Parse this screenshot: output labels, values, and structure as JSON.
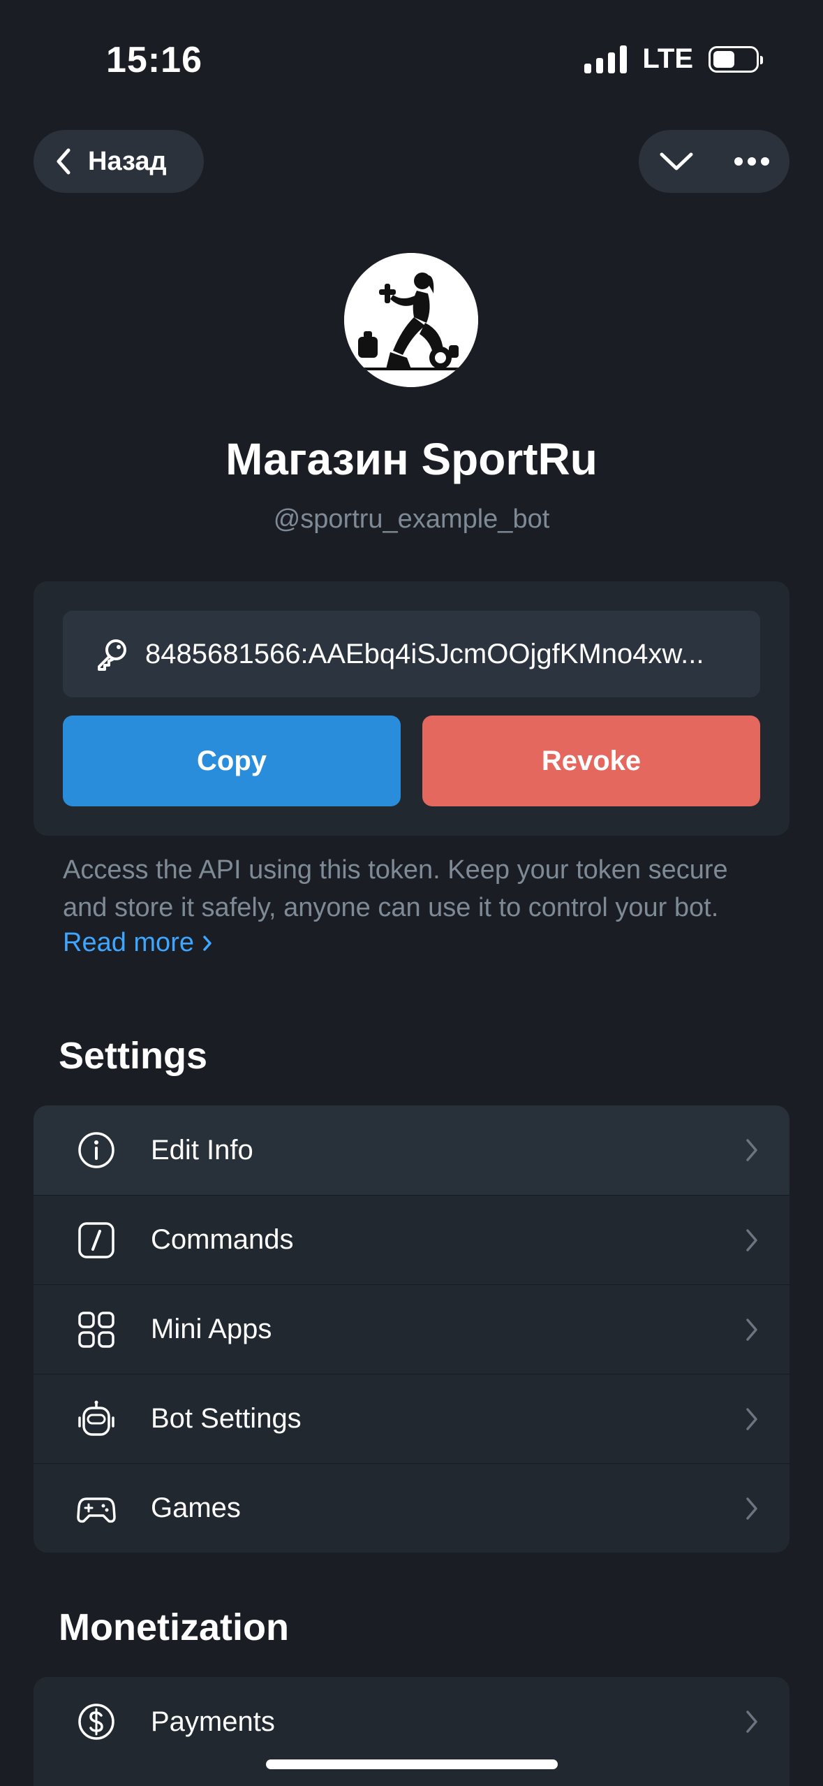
{
  "status_bar": {
    "time": "15:16",
    "network": "LTE"
  },
  "nav": {
    "back_label": "Назад"
  },
  "bot": {
    "name": "Магазин SportRu",
    "username": "@sportru_example_bot"
  },
  "token": {
    "value": "8485681566:AAEbq4iSJcmOOjgfKMno4xw...",
    "copy_label": "Copy",
    "revoke_label": "Revoke",
    "description": "Access the API using this token. Keep your token secure and store it safely, anyone can use it to control your bot.",
    "read_more": "Read more"
  },
  "settings": {
    "title": "Settings",
    "items": [
      {
        "label": "Edit Info",
        "icon": "info-icon"
      },
      {
        "label": "Commands",
        "icon": "slash-command-icon"
      },
      {
        "label": "Mini Apps",
        "icon": "apps-grid-icon"
      },
      {
        "label": "Bot Settings",
        "icon": "robot-icon"
      },
      {
        "label": "Games",
        "icon": "gamepad-icon"
      }
    ]
  },
  "monetization": {
    "title": "Monetization",
    "items": [
      {
        "label": "Payments",
        "icon": "dollar-circle-icon"
      }
    ]
  },
  "colors": {
    "background": "#1a1e24",
    "card": "#212830",
    "accent_blue": "#2a8ddc",
    "accent_red": "#e4685e",
    "link": "#3ea6ff",
    "secondary_text": "#7f8a97"
  }
}
